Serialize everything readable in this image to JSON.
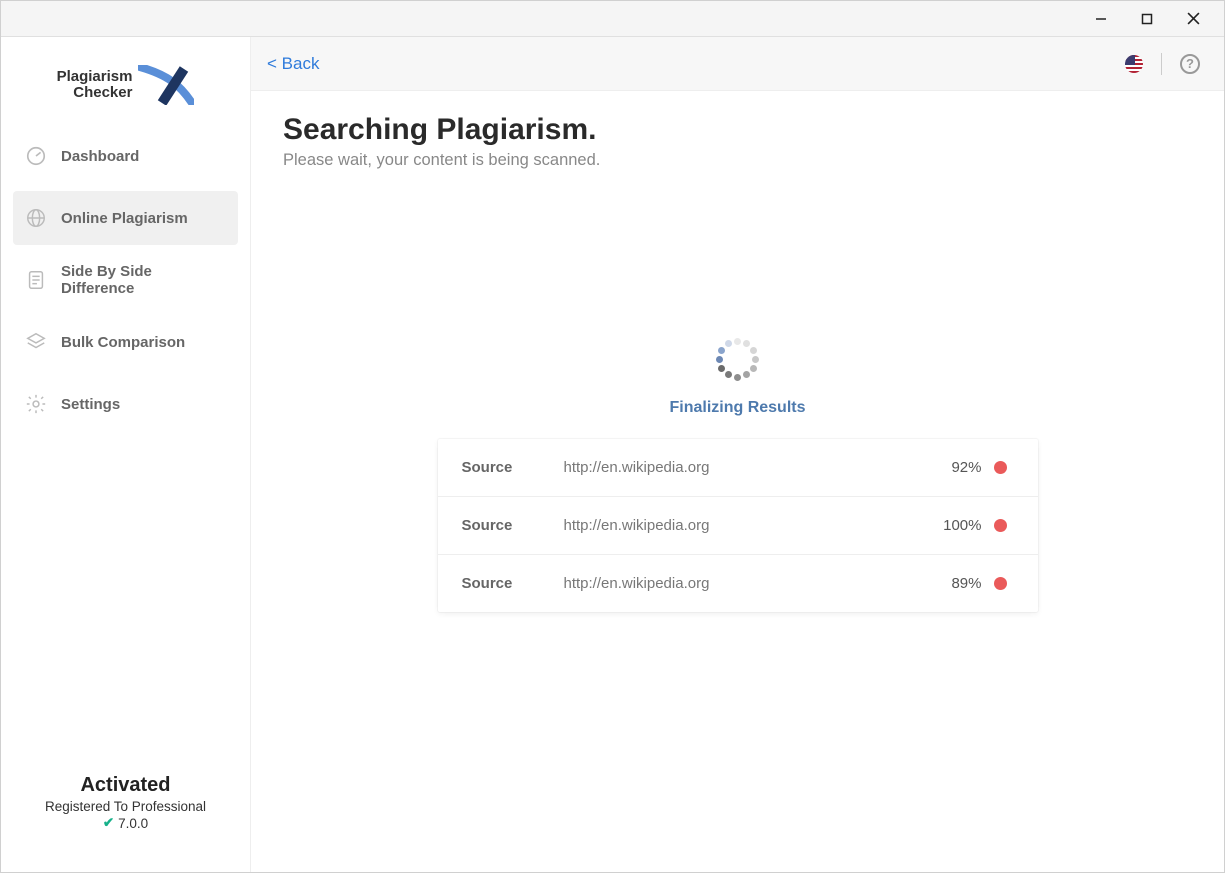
{
  "logo": {
    "line1": "Plagiarism",
    "line2": "Checker"
  },
  "sidebar": {
    "items": [
      {
        "label": "Dashboard"
      },
      {
        "label": "Online Plagiarism"
      },
      {
        "label": "Side By Side Difference"
      },
      {
        "label": "Bulk Comparison"
      },
      {
        "label": "Settings"
      }
    ],
    "footer": {
      "status": "Activated",
      "registration": "Registered To Professional",
      "version": "7.0.0"
    }
  },
  "topbar": {
    "back": "<  Back"
  },
  "page": {
    "title": "Searching Plagiarism.",
    "subtitle": "Please wait, your content is being scanned.",
    "status": "Finalizing Results"
  },
  "results": {
    "source_label": "Source",
    "rows": [
      {
        "url": "http://en.wikipedia.org",
        "percent": "92%",
        "dot_color": "#ea5a5a"
      },
      {
        "url": "http://en.wikipedia.org",
        "percent": "100%",
        "dot_color": "#ea5a5a"
      },
      {
        "url": "http://en.wikipedia.org",
        "percent": "89%",
        "dot_color": "#ea5a5a"
      }
    ]
  }
}
